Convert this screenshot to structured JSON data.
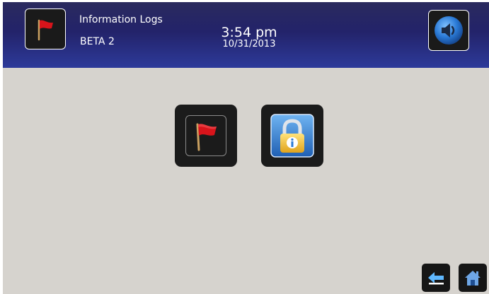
{
  "header": {
    "title": "Information Logs",
    "subtitle": "BETA 2",
    "time": "3:54 pm",
    "date": "10/31/2013",
    "flag_icon": "red-flag-icon",
    "sound_icon": "speaker-icon"
  },
  "main": {
    "tiles": [
      {
        "icon": "red-flag-icon"
      },
      {
        "icon": "padlock-info-icon"
      }
    ]
  },
  "footer": {
    "back_icon": "back-arrow-icon",
    "home_icon": "home-icon"
  },
  "colors": {
    "header_top": "#2a2a5e",
    "header_bottom": "#2d3a9a",
    "background": "#d6d3ce",
    "flag_red": "#d8141b",
    "accent_blue": "#2a7ad6"
  }
}
